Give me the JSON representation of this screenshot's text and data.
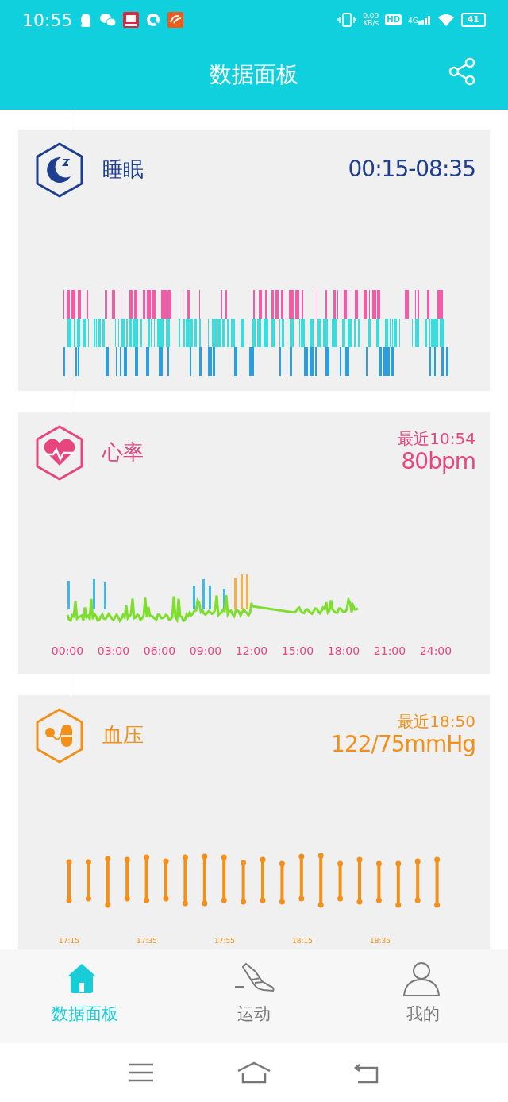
{
  "status_bar": {
    "time": "10:55",
    "net_speed": "0.00",
    "net_unit": "KB/s",
    "hd": "HD",
    "network": "4G",
    "battery": "41"
  },
  "header": {
    "title": "数据面板"
  },
  "cards": [
    {
      "kind": "sleep",
      "color": "#1e3f8f",
      "title": "睡眠",
      "value": "00:15-08:35"
    },
    {
      "kind": "heart",
      "color": "#e8457e",
      "title": "心率",
      "subtitle": "最近10:54",
      "value": "80bpm",
      "x_labels": [
        "00:00",
        "03:00",
        "06:00",
        "09:00",
        "12:00",
        "15:00",
        "18:00",
        "21:00",
        "24:00"
      ]
    },
    {
      "kind": "bp",
      "color": "#f39019",
      "title": "血压",
      "subtitle": "最近18:50",
      "value": "122/75mmHg",
      "x_labels": [
        "17:15",
        "17:35",
        "17:55",
        "18:15",
        "18:35"
      ]
    }
  ],
  "tabs": [
    {
      "kind": "home",
      "label": "数据面板",
      "selected": true
    },
    {
      "kind": "shoe",
      "label": "运动",
      "selected": false
    },
    {
      "kind": "person",
      "label": "我的",
      "selected": false
    }
  ]
}
